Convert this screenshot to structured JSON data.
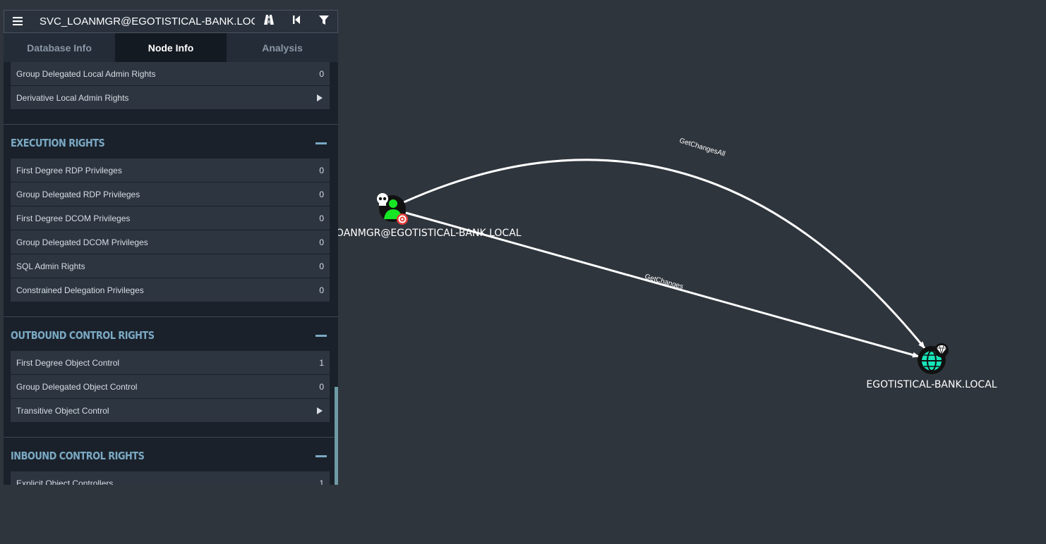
{
  "search": {
    "value": "SVC_LOANMGR@EGOTISTICAL-BANK.LOCAL"
  },
  "toolbar": {
    "menu_icon": "hamburger-icon",
    "pathfinding_icon": "road-icon",
    "back_icon": "step-back-icon",
    "filter_icon": "filter-icon"
  },
  "tabs": [
    {
      "label": "Database Info"
    },
    {
      "label": "Node Info"
    },
    {
      "label": "Analysis"
    }
  ],
  "local_admin": {
    "rows": [
      {
        "label": "Group Delegated Local Admin Rights",
        "value": "0"
      },
      {
        "label": "Derivative Local Admin Rights",
        "value": ""
      }
    ]
  },
  "execution": {
    "title": "EXECUTION RIGHTS",
    "rows": [
      {
        "label": "First Degree RDP Privileges",
        "value": "0"
      },
      {
        "label": "Group Delegated RDP Privileges",
        "value": "0"
      },
      {
        "label": "First Degree DCOM Privileges",
        "value": "0"
      },
      {
        "label": "Group Delegated DCOM Privileges",
        "value": "0"
      },
      {
        "label": "SQL Admin Rights",
        "value": "0"
      },
      {
        "label": "Constrained Delegation Privileges",
        "value": "0"
      }
    ]
  },
  "outbound": {
    "title": "OUTBOUND CONTROL RIGHTS",
    "rows": [
      {
        "label": "First Degree Object Control",
        "value": "1"
      },
      {
        "label": "Group Delegated Object Control",
        "value": "0"
      },
      {
        "label": "Transitive Object Control",
        "value": ""
      }
    ]
  },
  "inbound": {
    "title": "INBOUND CONTROL RIGHTS",
    "rows": [
      {
        "label": "Explicit Object Controllers",
        "value": "1"
      }
    ]
  },
  "graph": {
    "user_node_label": "SVC_LOANMGR@EGOTISTICAL-BANK.LOCAL",
    "domain_node_label": "EGOTISTICAL-BANK.LOCAL",
    "edge_top_label": "GetChangesAll",
    "edge_bottom_label": "GetChanges",
    "colors": {
      "background": "#2f353d",
      "user_fill": "#17e625",
      "domain_fill": "#17e6b9",
      "edge": "#ffffff"
    }
  }
}
